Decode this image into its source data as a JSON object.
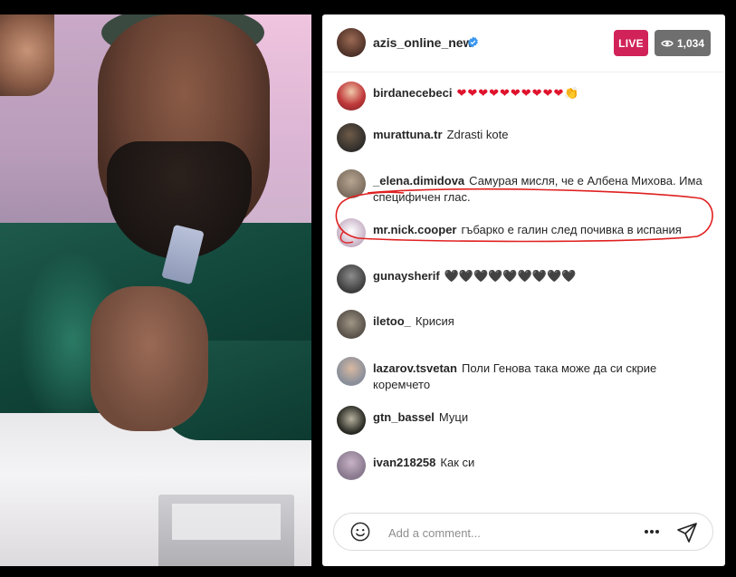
{
  "header": {
    "username": "azis_online_new",
    "verified": true,
    "live_label": "LIVE",
    "viewer_count": "1,034"
  },
  "comments": [
    {
      "username": "birdanecebeci",
      "text": "",
      "hearts": "❤❤❤❤❤❤❤❤❤❤",
      "emoji": "👏",
      "avatar_color": "#c0393b"
    },
    {
      "username": "murattuna.tr",
      "text": "Zdrasti kote",
      "avatar_color": "#2e2c2a"
    },
    {
      "username": "_elena.dimidova",
      "text": "Самурая мисля, че е Албена Михова. Има специфичен глас.",
      "avatar_color": "#7a6c5d"
    },
    {
      "username": "mr.nick.cooper",
      "text": "гъбарко е галин след почивка в испания",
      "avatar_color": "#d7c7d6"
    },
    {
      "username": "gunaysherif",
      "text": "",
      "black_hearts": "🖤🖤🖤🖤🖤🖤🖤🖤🖤",
      "avatar_color": "#3b3b3b"
    },
    {
      "username": "iletoo_",
      "text": "Крисия",
      "avatar_color": "#575048"
    },
    {
      "username": "lazarov.tsvetan",
      "text": "Поли Генова така може да си скрие коремчето",
      "avatar_color": "#8a8f9a"
    },
    {
      "username": "gtn_bassel",
      "text": "Муци",
      "avatar_color": "#2a2a24"
    },
    {
      "username": "ivan218258",
      "text": "Как си",
      "avatar_color": "#8a7a8f"
    }
  ],
  "comment_box": {
    "placeholder": "Add a comment..."
  },
  "colors": {
    "live_badge": "#d1225a",
    "viewers_badge": "#6f6f6f",
    "highlight": "#e02020",
    "verified": "#3897f0"
  }
}
